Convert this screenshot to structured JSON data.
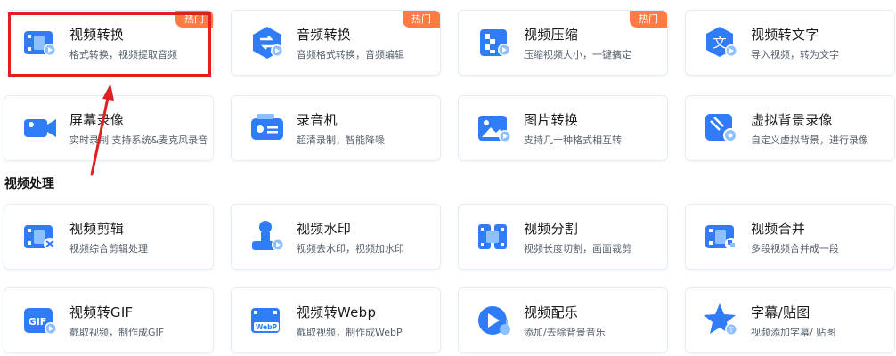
{
  "colors": {
    "icon_blue": "#2f7cf6",
    "icon_light": "#8ec0ff",
    "badge": "#ff7a45",
    "highlight": "#e02020"
  },
  "hot_badge": "热门",
  "section": {
    "title": "视频处理"
  },
  "tools": [
    {
      "title": "视频转换",
      "desc": "格式转换，视频提取音频",
      "icon": "video-convert-icon",
      "hot": true
    },
    {
      "title": "音频转换",
      "desc": "音频格式转换，音频编辑",
      "icon": "audio-convert-icon",
      "hot": true
    },
    {
      "title": "视频压缩",
      "desc": "压缩视频大小，一键搞定",
      "icon": "video-compress-icon",
      "hot": true
    },
    {
      "title": "视频转文字",
      "desc": "导入视频，转为文字",
      "icon": "video-to-text-icon",
      "hot": false
    },
    {
      "title": "屏幕录像",
      "desc": "实时录制 支持系统&麦克风录音",
      "icon": "screen-record-icon",
      "hot": false
    },
    {
      "title": "录音机",
      "desc": "超清录制，智能降噪",
      "icon": "recorder-icon",
      "hot": false
    },
    {
      "title": "图片转换",
      "desc": "支持几十种格式相互转",
      "icon": "image-convert-icon",
      "hot": false
    },
    {
      "title": "虚拟背景录像",
      "desc": "自定义虚拟背景，进行录像",
      "icon": "virtual-background-icon",
      "hot": false
    },
    {
      "title": "视频剪辑",
      "desc": "视频综合剪辑处理",
      "icon": "video-edit-icon",
      "hot": false
    },
    {
      "title": "视频水印",
      "desc": "视频去水印，视频加水印",
      "icon": "watermark-icon",
      "hot": false
    },
    {
      "title": "视频分割",
      "desc": "视频长度切割，画面裁剪",
      "icon": "video-split-icon",
      "hot": false
    },
    {
      "title": "视频合并",
      "desc": "多段视频合并成一段",
      "icon": "video-merge-icon",
      "hot": false
    },
    {
      "title": "视频转GIF",
      "desc": "截取视频，制作成GIF",
      "icon": "gif-icon",
      "hot": false
    },
    {
      "title": "视频转Webp",
      "desc": "截取视频，制作成WebP",
      "icon": "webp-icon",
      "hot": false
    },
    {
      "title": "视频配乐",
      "desc": "添加/去除背景音乐",
      "icon": "music-icon",
      "hot": false
    },
    {
      "title": "字幕/贴图",
      "desc": "视频添加字幕/ 贴图",
      "icon": "subtitle-sticker-icon",
      "hot": false
    }
  ]
}
